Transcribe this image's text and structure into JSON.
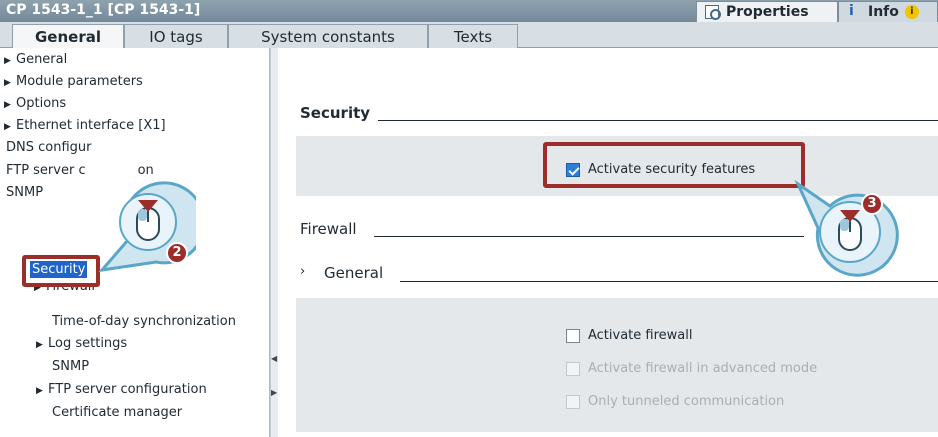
{
  "window": {
    "title": "CP 1543-1_1 [CP 1543-1]",
    "properties_tab": "Properties",
    "info_tab": "Info",
    "info_badge": "i"
  },
  "tabs": [
    {
      "label": "General",
      "active": true
    },
    {
      "label": "IO tags",
      "active": false
    },
    {
      "label": "System constants",
      "active": false
    },
    {
      "label": "Texts",
      "active": false
    }
  ],
  "tree": {
    "items": [
      {
        "label": "General",
        "expander": "▶"
      },
      {
        "label": "Module parameters",
        "expander": "▶"
      },
      {
        "label": "Options",
        "expander": "▶"
      },
      {
        "label": "Ethernet interface [X1]",
        "expander": "▶"
      },
      {
        "label": "DNS configur",
        "expander": ""
      },
      {
        "label": "FTP server c",
        "suffix": "on",
        "expander": ""
      },
      {
        "label": "SNMP",
        "expander": ""
      },
      {
        "label": "Security",
        "expander": "",
        "selected": true
      },
      {
        "label": "Firewall",
        "expander": "▶"
      },
      {
        "label": "Time-of-day synchronization",
        "expander": ""
      },
      {
        "label": "Log settings",
        "expander": "▶"
      },
      {
        "label": "SNMP",
        "expander": ""
      },
      {
        "label": "FTP server configuration",
        "expander": "▶"
      },
      {
        "label": "Certificate manager",
        "expander": ""
      }
    ]
  },
  "content": {
    "security_heading": "Security",
    "activate_security": "Activate security features",
    "firewall_heading": "Firewall",
    "general_chevron": "›",
    "general_heading": "General",
    "activate_firewall": "Activate firewall",
    "advanced_mode": "Activate firewall in advanced mode",
    "tunneled": "Only tunneled communication"
  },
  "callouts": {
    "step2": "2",
    "step3": "3"
  },
  "colors": {
    "highlight": "#9b2d2a",
    "selection": "#1f64c8",
    "callout": "#5aa6c9"
  }
}
